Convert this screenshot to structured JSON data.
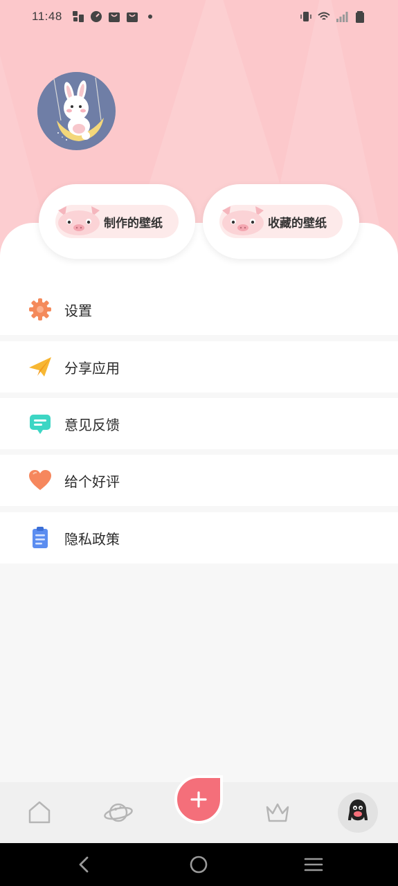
{
  "status_bar": {
    "time": "11:48",
    "left_icons": [
      "notification-icon",
      "gauge-icon",
      "bag-icon",
      "bag-icon",
      "dot-icon"
    ],
    "right_icons": [
      "vibrate-icon",
      "wifi-icon",
      "signal-icon",
      "battery-icon"
    ]
  },
  "header": {
    "avatar": "bunny-on-swing-avatar",
    "background_color": "#fcc8cb"
  },
  "wallpaper_buttons": [
    {
      "label": "制作的壁纸",
      "icon": "pig-icon"
    },
    {
      "label": "收藏的壁纸",
      "icon": "pig-icon"
    }
  ],
  "menu": {
    "items": [
      {
        "label": "设置",
        "icon": "gear-icon",
        "color": "#f48a5b"
      },
      {
        "label": "分享应用",
        "icon": "paper-plane-icon",
        "color": "#f7b733"
      },
      {
        "label": "意见反馈",
        "icon": "message-icon",
        "color": "#3dd6c4"
      },
      {
        "label": "给个好评",
        "icon": "heart-icon",
        "color": "#f6875d"
      },
      {
        "label": "隐私政策",
        "icon": "clipboard-icon",
        "color": "#5b8df0"
      }
    ]
  },
  "tabbar": {
    "tabs": [
      {
        "name": "home",
        "icon": "home-icon"
      },
      {
        "name": "discover",
        "icon": "planet-icon"
      },
      {
        "name": "create",
        "icon": "plus-icon"
      },
      {
        "name": "vip",
        "icon": "crown-icon"
      },
      {
        "name": "me",
        "icon": "penguin-icon",
        "active": true
      }
    ],
    "accent": "#f46f7a"
  },
  "system_nav": {
    "buttons": [
      "back-icon",
      "home-circle-icon",
      "menu-icon"
    ]
  }
}
